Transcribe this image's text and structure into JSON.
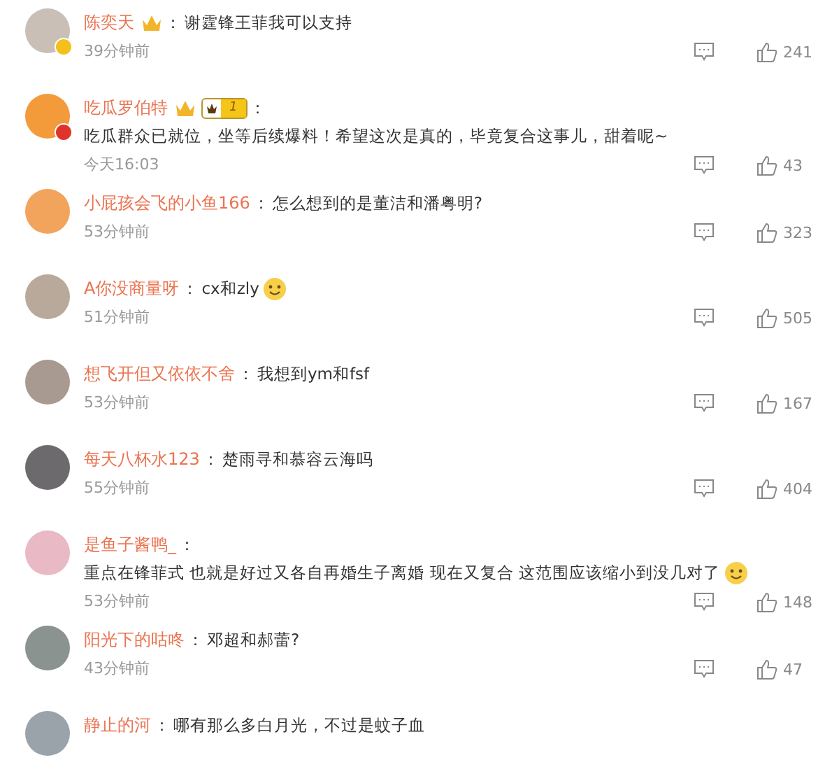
{
  "comments": [
    {
      "avatar": {
        "color": "#c9bfb6"
      },
      "verified": {
        "color": "#f3c01c"
      },
      "name": "陈奕天",
      "crown": true,
      "separator": "：",
      "text": "谢霆锋王菲我可以支持",
      "time": "39分钟前",
      "likes": "241"
    },
    {
      "avatar": {
        "color": "#f39a3a"
      },
      "verified": {
        "color": "#e0332a"
      },
      "name": "吃瓜罗伯特",
      "crown": true,
      "level": "1",
      "separator": "：",
      "text": "吃瓜群众已就位，坐等后续爆料！希望这次是真的，毕竟复合这事儿，甜着呢~",
      "time": "今天16:03",
      "likes": "43"
    },
    {
      "avatar": {
        "color": "#f2a45c"
      },
      "name": "小屁孩会飞的小鱼166",
      "separator": "：",
      "text": "怎么想到的是董洁和潘粤明?",
      "time": "53分钟前",
      "likes": "323"
    },
    {
      "avatar": {
        "color": "#b8a99a"
      },
      "name": "A你没商量呀",
      "separator": "：",
      "text": "cx和zly",
      "emoji": true,
      "time": "51分钟前",
      "likes": "505"
    },
    {
      "avatar": {
        "color": "#a89a90"
      },
      "name": "想飞开但又依依不舍",
      "separator": "：",
      "text": "我想到ym和fsf",
      "time": "53分钟前",
      "likes": "167"
    },
    {
      "avatar": {
        "color": "#6d6a6e"
      },
      "name": "每天八杯水123",
      "separator": "：",
      "text": "楚雨寻和慕容云海吗",
      "time": "55分钟前",
      "likes": "404"
    },
    {
      "avatar": {
        "color": "#e9b9c6"
      },
      "name": "是鱼子酱鸭_",
      "separator": "：",
      "text": "重点在锋菲式 也就是好过又各自再婚生子离婚 现在又复合 这范围应该缩小到没几对了",
      "emoji": true,
      "time": "53分钟前",
      "likes": "148"
    },
    {
      "avatar": {
        "color": "#8a938f"
      },
      "name": "阳光下的咕咚",
      "separator": "：",
      "text": "邓超和郝蕾?",
      "time": "43分钟前",
      "likes": "47"
    },
    {
      "avatar": {
        "color": "#9aa2aa"
      },
      "name": "静止的河",
      "separator": "：",
      "text": "哪有那么多白月光，不过是蚊子血"
    }
  ]
}
